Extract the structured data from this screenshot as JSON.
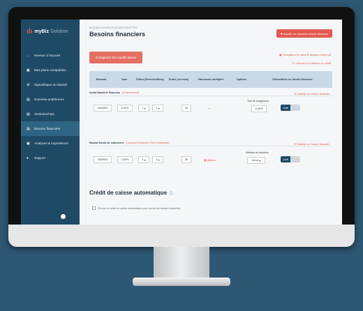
{
  "sidebar": {
    "logo": {
      "name": "myBiz",
      "sub": "Solution"
    },
    "items": [
      {
        "icon": "←",
        "label": "Revenir à l'accueil"
      },
      {
        "icon": "▦",
        "label": "Mes plans comptables"
      },
      {
        "icon": "⚙",
        "label": "Signalétique du dossier"
      },
      {
        "icon": "▤",
        "label": "Données antérieures"
      },
      {
        "icon": "▤",
        "label": "Ventes/achats"
      },
      {
        "icon": "▤",
        "label": "Besoins financiers"
      },
      {
        "icon": "▣",
        "label": "Analyses & impressions"
      },
      {
        "icon": "●",
        "label": "Support"
      }
    ],
    "active_index": 5
  },
  "header": {
    "breadcrumb": "BESOINS D'INVESTISSEMENTS/DETTES",
    "title": "Besoins financiers",
    "add_button": "Ajouter un nouveau besoin financier"
  },
  "toolbar": {
    "save_label": "Enregistrer les modifications",
    "link_save_table": "Enregistrer en dans le tableau d'emprunt",
    "link_calc": "Calculer le problème du crédit"
  },
  "table": {
    "columns": [
      "Montant",
      "Taux",
      "Début (Exercice/Mois)",
      "Durée (en mois)",
      "Paiements multiples",
      "Options",
      "Déductibles un besoin financier"
    ],
    "rows": [
      {
        "title": "Achat Machine Nouveau",
        "subtitle": "(Financement)",
        "link": "Détailler un besoin financier",
        "amount": "3000000",
        "rate": "4,00%",
        "start_year": "1",
        "start_month": "1",
        "duration": "36",
        "payments": "—",
        "option_label": "Taux de chargement",
        "option_value": "0,00%",
        "toggle": "Actif"
      },
      {
        "title": "Rachat fonds de commerce",
        "subtitle": "(Transport financier d'une entreprise)",
        "link": "Détailler un besoin financier",
        "amount": "3500000",
        "rate": "4,50%",
        "start_year": "1",
        "start_month": "4",
        "duration": "36",
        "payments": "Afficher",
        "option_label": "Méthode de franchise",
        "option_value": "Emoti",
        "toggle": "Actif"
      }
    ]
  },
  "credit_section": {
    "title": "Crédit de caisse automatique",
    "hint": "Prévoir un crédit de caisse automatique pour couvrir les besoins financiers"
  },
  "colors": {
    "sidebar": "#1f4a66",
    "accent": "#e35a4f",
    "table_header": "#c9d9e6",
    "background": "#2d5772"
  }
}
